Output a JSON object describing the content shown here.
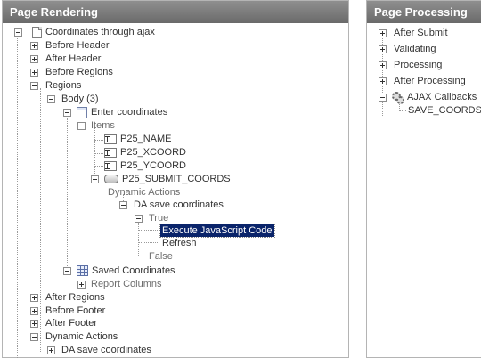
{
  "left_panel": {
    "title": "Page Rendering",
    "page_label": "Coordinates through ajax",
    "items": {
      "before_header": "Before Header",
      "after_header": "After Header",
      "before_regions": "Before Regions",
      "regions": "Regions",
      "body": "Body (3)",
      "enter_coordinates": "Enter coordinates",
      "items_group": "Items",
      "p25_name": "P25_NAME",
      "p25_xcoord": "P25_XCOORD",
      "p25_ycoord": "P25_YCOORD",
      "p25_submit": "P25_SUBMIT_COORDS",
      "dynamic_actions": "Dynamic Actions",
      "da_save": "DA save coordinates",
      "true_branch": "True",
      "execute_js": "Execute JavaScript Code",
      "refresh": "Refresh",
      "false_branch": "False",
      "saved_coordinates": "Saved Coordinates",
      "report_columns": "Report Columns",
      "after_regions": "After Regions",
      "before_footer": "Before Footer",
      "after_footer": "After Footer",
      "dynamic_actions_root": "Dynamic Actions",
      "da_save_root": "DA save coordinates"
    }
  },
  "right_panel": {
    "title": "Page Processing",
    "items": {
      "after_submit": "After Submit",
      "validating": "Validating",
      "processing": "Processing",
      "after_processing": "After Processing",
      "ajax_callbacks": "AJAX Callbacks",
      "save_coords": "SAVE_COORDS"
    }
  },
  "colors": {
    "header_bg": "#7a7a7a",
    "selection_bg": "#0a246a"
  }
}
